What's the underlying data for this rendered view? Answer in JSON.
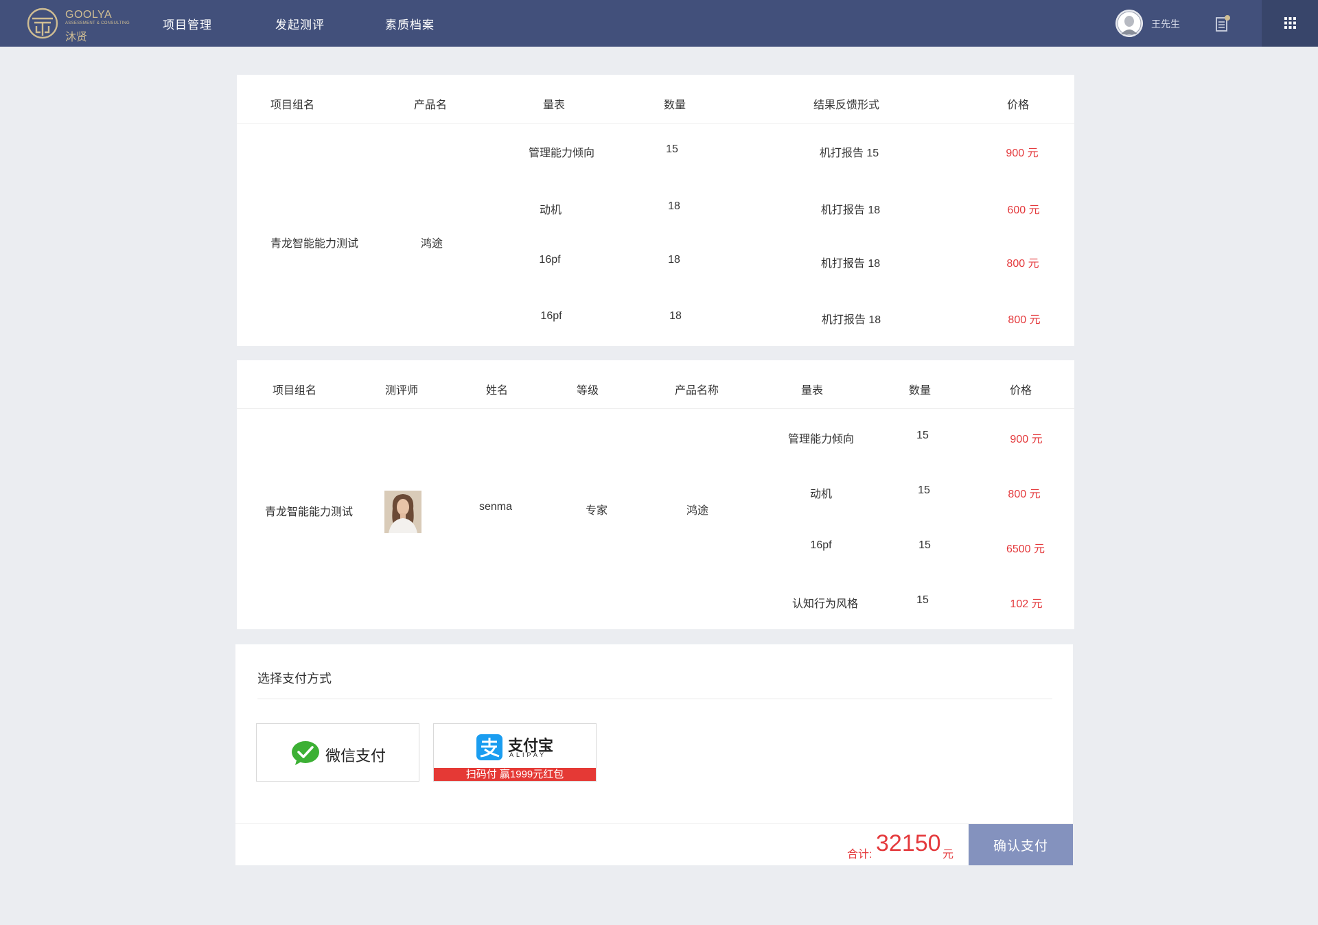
{
  "header": {
    "logo_en": "GOOLYA",
    "logo_sub": "ASSESSMENT & CONSULTING",
    "logo_cn": "沐贤",
    "nav": [
      "项目管理",
      "发起测评",
      "素质档案"
    ],
    "username": "王先生",
    "colors": {
      "bar": "#42507b",
      "accent": "#cfbd93"
    }
  },
  "table1": {
    "headers": [
      "项目组名",
      "产品名",
      "量表",
      "数量",
      "结果反馈形式",
      "价格"
    ],
    "group": "青龙智能能力测试",
    "product": "鸿途",
    "rows": [
      {
        "scale": "管理能力倾向",
        "qty": "15",
        "feedback": "机打报告 15",
        "price": "900 元"
      },
      {
        "scale": "动机",
        "qty": "18",
        "feedback": "机打报告 18",
        "price": "600 元"
      },
      {
        "scale": "16pf",
        "qty": "18",
        "feedback": "机打报告 18",
        "price": "800 元"
      },
      {
        "scale": "16pf",
        "qty": "18",
        "feedback": "机打报告 18",
        "price": "800 元"
      }
    ]
  },
  "table2": {
    "headers": [
      "项目组名",
      "测评师",
      "姓名",
      "等级",
      "产品名称",
      "量表",
      "数量",
      "价格"
    ],
    "group": "青龙智能能力测试",
    "assessor_photo": "portrait",
    "name": "senma",
    "level": "专家",
    "product": "鸿途",
    "rows": [
      {
        "scale": "管理能力倾向",
        "qty": "15",
        "price": "900 元"
      },
      {
        "scale": "动机",
        "qty": "15",
        "price": "800 元"
      },
      {
        "scale": "16pf",
        "qty": "15",
        "price": "6500 元"
      },
      {
        "scale": "认知行为风格",
        "qty": "15",
        "price": "102 元"
      }
    ]
  },
  "payment": {
    "title": "选择支付方式",
    "wechat_label": "微信支付",
    "alipay_label": "支付宝",
    "alipay_sub": "ALIPAY",
    "alipay_banner": "扫码付 赢1999元红包",
    "total_label": "合计:",
    "total_value": "32150",
    "total_unit": "元",
    "confirm_label": "确认支付",
    "price_color": "#e4393c",
    "button_color": "#8492be"
  }
}
